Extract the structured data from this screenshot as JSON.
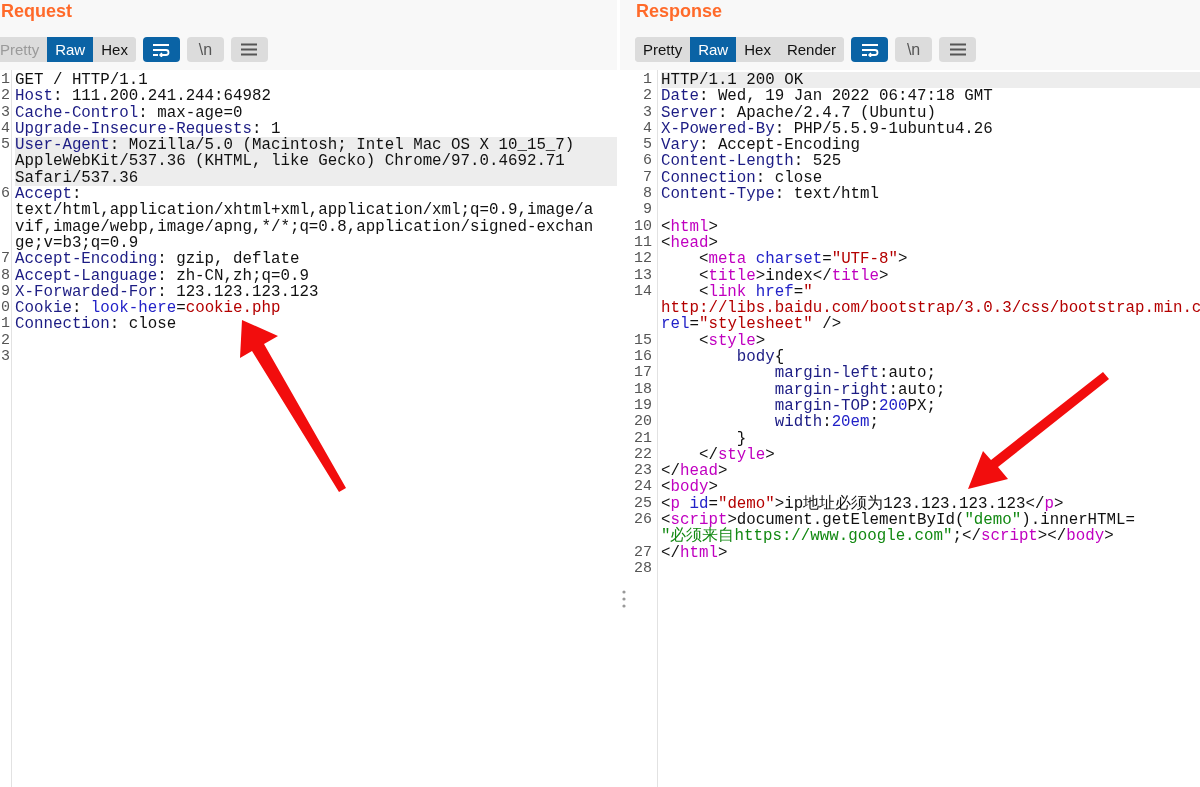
{
  "request": {
    "title": "Request",
    "tabs": [
      {
        "label": "Pretty",
        "selected": false,
        "disabled": true
      },
      {
        "label": "Raw",
        "selected": true,
        "disabled": false
      },
      {
        "label": "Hex",
        "selected": false,
        "disabled": false
      }
    ],
    "toggles": [
      {
        "kind": "wrap",
        "on": true
      },
      {
        "kind": "newline",
        "label": "\\n",
        "on": false
      },
      {
        "kind": "menu",
        "on": false
      }
    ],
    "lines": [
      {
        "number": "1",
        "selected": false,
        "rows": [
          {
            "tokens": [
              {
                "kind": "plain",
                "text": "GET / HTTP/1.1"
              }
            ]
          }
        ]
      },
      {
        "number": "2",
        "selected": false,
        "rows": [
          {
            "tokens": [
              {
                "kind": "name",
                "text": "Host"
              },
              {
                "kind": "plain",
                "text": ": 111.200.241.244:64982"
              }
            ]
          }
        ]
      },
      {
        "number": "3",
        "selected": false,
        "rows": [
          {
            "tokens": [
              {
                "kind": "name",
                "text": "Cache-Control"
              },
              {
                "kind": "plain",
                "text": ": max-age=0"
              }
            ]
          }
        ]
      },
      {
        "number": "4",
        "selected": false,
        "rows": [
          {
            "tokens": [
              {
                "kind": "name",
                "text": "Upgrade-Insecure-Requests"
              },
              {
                "kind": "plain",
                "text": ": 1"
              }
            ]
          }
        ]
      },
      {
        "number": "5",
        "selected": true,
        "rows": [
          {
            "tokens": [
              {
                "kind": "name",
                "text": "User-Agent"
              },
              {
                "kind": "plain",
                "text": ": Mozilla/5.0 (Macintosh; Intel Mac OS X 10_15_7)"
              }
            ]
          },
          {
            "tokens": [
              {
                "kind": "plain",
                "text": "AppleWebKit/537.36 (KHTML, like Gecko) Chrome/97.0.4692.71"
              }
            ]
          },
          {
            "tokens": [
              {
                "kind": "plain",
                "text": "Safari/537.36"
              }
            ]
          }
        ]
      },
      {
        "number": "6",
        "selected": false,
        "rows": [
          {
            "tokens": [
              {
                "kind": "name",
                "text": "Accept"
              },
              {
                "kind": "plain",
                "text": ":"
              }
            ]
          },
          {
            "tokens": [
              {
                "kind": "plain",
                "text": "text/html,application/xhtml+xml,application/xml;q=0.9,image/a"
              }
            ]
          },
          {
            "tokens": [
              {
                "kind": "plain",
                "text": "vif,image/webp,image/apng,*/*;q=0.8,application/signed-exchan"
              }
            ]
          },
          {
            "tokens": [
              {
                "kind": "plain",
                "text": "ge;v=b3;q=0.9"
              }
            ]
          }
        ]
      },
      {
        "number": "7",
        "selected": false,
        "rows": [
          {
            "tokens": [
              {
                "kind": "name",
                "text": "Accept-Encoding"
              },
              {
                "kind": "plain",
                "text": ": gzip, deflate"
              }
            ]
          }
        ]
      },
      {
        "number": "8",
        "selected": false,
        "rows": [
          {
            "tokens": [
              {
                "kind": "name",
                "text": "Accept-Language"
              },
              {
                "kind": "plain",
                "text": ": zh-CN,zh;q=0.9"
              }
            ]
          }
        ]
      },
      {
        "number": "9",
        "selected": false,
        "rows": [
          {
            "tokens": [
              {
                "kind": "name",
                "text": "X-Forwarded-For"
              },
              {
                "kind": "plain",
                "text": ": 123.123.123.123"
              }
            ]
          }
        ]
      },
      {
        "number": "0",
        "selected": false,
        "rows": [
          {
            "tokens": [
              {
                "kind": "name",
                "text": "Cookie"
              },
              {
                "kind": "plain",
                "text": ": "
              },
              {
                "kind": "attr",
                "text": "look-here"
              },
              {
                "kind": "plain",
                "text": "="
              },
              {
                "kind": "str",
                "text": "cookie.php"
              }
            ]
          }
        ]
      },
      {
        "number": "1",
        "selected": false,
        "rows": [
          {
            "tokens": [
              {
                "kind": "name",
                "text": "Connection"
              },
              {
                "kind": "plain",
                "text": ": close"
              }
            ]
          }
        ]
      },
      {
        "number": "2",
        "selected": false
      },
      {
        "number": "3",
        "selected": false
      }
    ]
  },
  "response": {
    "title": "Response",
    "tabs": [
      {
        "label": "Pretty",
        "selected": false,
        "disabled": false
      },
      {
        "label": "Raw",
        "selected": true,
        "disabled": false
      },
      {
        "label": "Hex",
        "selected": false,
        "disabled": false
      },
      {
        "label": "Render",
        "selected": false,
        "disabled": false
      }
    ],
    "toggles": [
      {
        "kind": "wrap",
        "on": true
      },
      {
        "kind": "newline",
        "label": "\\n",
        "on": false
      },
      {
        "kind": "menu",
        "on": false
      }
    ],
    "lines": [
      {
        "number": "1",
        "selected": true,
        "rows": [
          {
            "tokens": [
              {
                "kind": "plain",
                "text": "HTTP/1.1 200 OK"
              }
            ]
          }
        ]
      },
      {
        "number": "2",
        "selected": false,
        "rows": [
          {
            "tokens": [
              {
                "kind": "name",
                "text": "Date"
              },
              {
                "kind": "plain",
                "text": ": Wed, 19 Jan 2022 06:47:18 GMT"
              }
            ]
          }
        ]
      },
      {
        "number": "3",
        "selected": false,
        "rows": [
          {
            "tokens": [
              {
                "kind": "name",
                "text": "Server"
              },
              {
                "kind": "plain",
                "text": ": Apache/2.4.7 (Ubuntu)"
              }
            ]
          }
        ]
      },
      {
        "number": "4",
        "selected": false,
        "rows": [
          {
            "tokens": [
              {
                "kind": "name",
                "text": "X-Powered-By"
              },
              {
                "kind": "plain",
                "text": ": PHP/5.5.9-1ubuntu4.26"
              }
            ]
          }
        ]
      },
      {
        "number": "5",
        "selected": false,
        "rows": [
          {
            "tokens": [
              {
                "kind": "name",
                "text": "Vary"
              },
              {
                "kind": "plain",
                "text": ": Accept-Encoding"
              }
            ]
          }
        ]
      },
      {
        "number": "6",
        "selected": false,
        "rows": [
          {
            "tokens": [
              {
                "kind": "name",
                "text": "Content-Length"
              },
              {
                "kind": "plain",
                "text": ": 525"
              }
            ]
          }
        ]
      },
      {
        "number": "7",
        "selected": false,
        "rows": [
          {
            "tokens": [
              {
                "kind": "name",
                "text": "Connection"
              },
              {
                "kind": "plain",
                "text": ": close"
              }
            ]
          }
        ]
      },
      {
        "number": "8",
        "selected": false,
        "rows": [
          {
            "tokens": [
              {
                "kind": "name",
                "text": "Content-Type"
              },
              {
                "kind": "plain",
                "text": ": text/html"
              }
            ]
          }
        ]
      },
      {
        "number": "9",
        "selected": false
      },
      {
        "number": "10",
        "selected": false,
        "rows": [
          {
            "tokens": [
              {
                "kind": "plain",
                "text": "<"
              },
              {
                "kind": "tag",
                "text": "html"
              },
              {
                "kind": "plain",
                "text": ">"
              }
            ]
          }
        ]
      },
      {
        "number": "11",
        "selected": false,
        "rows": [
          {
            "tokens": [
              {
                "kind": "plain",
                "text": "<"
              },
              {
                "kind": "tag",
                "text": "head"
              },
              {
                "kind": "plain",
                "text": ">"
              }
            ]
          }
        ]
      },
      {
        "number": "12",
        "selected": false,
        "rows": [
          {
            "tokens": [
              {
                "kind": "plain",
                "text": "    <"
              },
              {
                "kind": "tag",
                "text": "meta"
              },
              {
                "kind": "attr",
                "text": " charset"
              },
              {
                "kind": "plain",
                "text": "="
              },
              {
                "kind": "str",
                "text": "\"UTF-8\""
              },
              {
                "kind": "plain",
                "text": ">"
              }
            ]
          }
        ]
      },
      {
        "number": "13",
        "selected": false,
        "rows": [
          {
            "tokens": [
              {
                "kind": "plain",
                "text": "    <"
              },
              {
                "kind": "tag",
                "text": "title"
              },
              {
                "kind": "plain",
                "text": ">index</"
              },
              {
                "kind": "tag",
                "text": "title"
              },
              {
                "kind": "plain",
                "text": ">"
              }
            ]
          }
        ]
      },
      {
        "number": "14",
        "selected": false,
        "rows": [
          {
            "tokens": [
              {
                "kind": "plain",
                "text": "    <"
              },
              {
                "kind": "tag",
                "text": "link"
              },
              {
                "kind": "attr",
                "text": " href"
              },
              {
                "kind": "plain",
                "text": "="
              },
              {
                "kind": "str",
                "text": "\""
              }
            ]
          },
          {
            "tokens": [
              {
                "kind": "str",
                "text": "http://libs.baidu.com/bootstrap/3.0.3/css/bootstrap.min.c"
              }
            ]
          },
          {
            "tokens": [
              {
                "kind": "attr",
                "text": "rel"
              },
              {
                "kind": "plain",
                "text": "="
              },
              {
                "kind": "str",
                "text": "\"stylesheet\""
              },
              {
                "kind": "plain",
                "text": " />"
              }
            ]
          }
        ]
      },
      {
        "number": "15",
        "selected": false,
        "rows": [
          {
            "tokens": [
              {
                "kind": "plain",
                "text": "    <"
              },
              {
                "kind": "tag",
                "text": "style"
              },
              {
                "kind": "plain",
                "text": ">"
              }
            ]
          }
        ]
      },
      {
        "number": "16",
        "selected": false,
        "rows": [
          {
            "tokens": [
              {
                "kind": "name",
                "text": "        body"
              },
              {
                "kind": "plain",
                "text": "{"
              }
            ]
          }
        ]
      },
      {
        "number": "17",
        "selected": false,
        "rows": [
          {
            "tokens": [
              {
                "kind": "name",
                "text": "            margin-left"
              },
              {
                "kind": "plain",
                "text": ":auto;"
              }
            ]
          }
        ]
      },
      {
        "number": "18",
        "selected": false,
        "rows": [
          {
            "tokens": [
              {
                "kind": "name",
                "text": "            margin-right"
              },
              {
                "kind": "plain",
                "text": ":auto;"
              }
            ]
          }
        ]
      },
      {
        "number": "19",
        "selected": false,
        "rows": [
          {
            "tokens": [
              {
                "kind": "name",
                "text": "            margin-TOP"
              },
              {
                "kind": "plain",
                "text": ":"
              },
              {
                "kind": "num",
                "text": "200"
              },
              {
                "kind": "plain",
                "text": "PX;"
              }
            ]
          }
        ]
      },
      {
        "number": "20",
        "selected": false,
        "rows": [
          {
            "tokens": [
              {
                "kind": "name",
                "text": "            width"
              },
              {
                "kind": "plain",
                "text": ":"
              },
              {
                "kind": "num",
                "text": "20em"
              },
              {
                "kind": "plain",
                "text": ";"
              }
            ]
          }
        ]
      },
      {
        "number": "21",
        "selected": false,
        "rows": [
          {
            "tokens": [
              {
                "kind": "plain",
                "text": "        }"
              }
            ]
          }
        ]
      },
      {
        "number": "22",
        "selected": false,
        "rows": [
          {
            "tokens": [
              {
                "kind": "plain",
                "text": "    </"
              },
              {
                "kind": "tag",
                "text": "style"
              },
              {
                "kind": "plain",
                "text": ">"
              }
            ]
          }
        ]
      },
      {
        "number": "23",
        "selected": false,
        "rows": [
          {
            "tokens": [
              {
                "kind": "plain",
                "text": "</"
              },
              {
                "kind": "tag",
                "text": "head"
              },
              {
                "kind": "plain",
                "text": ">"
              }
            ]
          }
        ]
      },
      {
        "number": "24",
        "selected": false,
        "rows": [
          {
            "tokens": [
              {
                "kind": "plain",
                "text": "<"
              },
              {
                "kind": "tag",
                "text": "body"
              },
              {
                "kind": "plain",
                "text": ">"
              }
            ]
          }
        ]
      },
      {
        "number": "25",
        "selected": false,
        "rows": [
          {
            "tokens": [
              {
                "kind": "plain",
                "text": "<"
              },
              {
                "kind": "tag",
                "text": "p"
              },
              {
                "kind": "attr",
                "text": " id"
              },
              {
                "kind": "plain",
                "text": "="
              },
              {
                "kind": "str",
                "text": "\"demo\""
              },
              {
                "kind": "plain",
                "text": ">ip地址必须为123.123.123.123</"
              },
              {
                "kind": "tag",
                "text": "p"
              },
              {
                "kind": "plain",
                "text": ">"
              }
            ]
          }
        ]
      },
      {
        "number": "26",
        "selected": false,
        "rows": [
          {
            "tokens": [
              {
                "kind": "plain",
                "text": "<"
              },
              {
                "kind": "tag",
                "text": "script"
              },
              {
                "kind": "plain",
                "text": ">document.getElementById("
              },
              {
                "kind": "jsstr",
                "text": "\"demo\""
              },
              {
                "kind": "plain",
                "text": ").innerHTML="
              }
            ]
          },
          {
            "tokens": [
              {
                "kind": "jsstr",
                "text": "\"必须来自https://www.google.com\""
              },
              {
                "kind": "plain",
                "text": ";</"
              },
              {
                "kind": "tag",
                "text": "script"
              },
              {
                "kind": "plain",
                "text": "></"
              },
              {
                "kind": "tag",
                "text": "body"
              },
              {
                "kind": "plain",
                "text": ">"
              }
            ]
          }
        ]
      },
      {
        "number": "27",
        "selected": false,
        "rows": [
          {
            "tokens": [
              {
                "kind": "plain",
                "text": "</"
              },
              {
                "kind": "tag",
                "text": "html"
              },
              {
                "kind": "plain",
                "text": ">"
              }
            ]
          }
        ]
      },
      {
        "number": "28",
        "selected": false
      }
    ]
  }
}
